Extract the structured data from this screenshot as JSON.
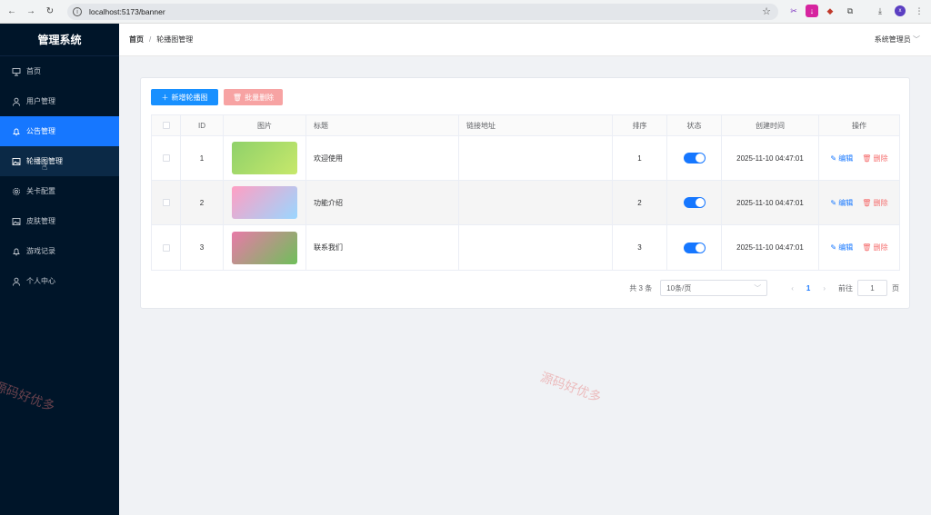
{
  "browser": {
    "url": "localhost:5173/banner",
    "avatar_letter": "x"
  },
  "sidebar": {
    "title": "管理系统",
    "items": [
      {
        "label": "首页",
        "icon": "presentation-icon"
      },
      {
        "label": "用户管理",
        "icon": "user-icon"
      },
      {
        "label": "公告管理",
        "icon": "bell-icon"
      },
      {
        "label": "轮播图管理",
        "icon": "image-icon"
      },
      {
        "label": "关卡配置",
        "icon": "gear-icon"
      },
      {
        "label": "皮肤管理",
        "icon": "image-icon"
      },
      {
        "label": "游戏记录",
        "icon": "bell-icon"
      },
      {
        "label": "个人中心",
        "icon": "user-icon"
      }
    ]
  },
  "header": {
    "breadcrumb_home": "首页",
    "breadcrumb_sep": "/",
    "breadcrumb_current": "轮播图管理",
    "user": "系统管理员"
  },
  "toolbar": {
    "add_label": "新增轮播图",
    "batch_delete_label": "批量删除"
  },
  "table": {
    "headers": [
      "ID",
      "图片",
      "标题",
      "链接地址",
      "排序",
      "状态",
      "创建时间",
      "操作"
    ],
    "rows": [
      {
        "id": "1",
        "title": "欢迎使用",
        "link": "",
        "sort": "1",
        "status": true,
        "created": "2025-11-10 04:47:01",
        "thumb_colors": [
          "#8fd16a",
          "#c7e86b"
        ]
      },
      {
        "id": "2",
        "title": "功能介绍",
        "link": "",
        "sort": "2",
        "status": true,
        "created": "2025-11-10 04:47:01",
        "thumb_colors": [
          "#ff9fc3",
          "#9ad6ff"
        ]
      },
      {
        "id": "3",
        "title": "联系我们",
        "link": "",
        "sort": "3",
        "status": true,
        "created": "2025-11-10 04:47:01",
        "thumb_colors": [
          "#6fbf5a",
          "#e87aa8"
        ]
      }
    ],
    "edit_label": "编辑",
    "delete_label": "删除"
  },
  "pagination": {
    "total": "共 3 条",
    "page_size": "10条/页",
    "current": "1",
    "goto_label": "前往",
    "goto_value": "1",
    "page_suffix": "页"
  },
  "watermark": "源码好优多",
  "colors": {
    "primary": "#1677ff",
    "sidebar": "#001529",
    "danger": "#f56c6c"
  }
}
